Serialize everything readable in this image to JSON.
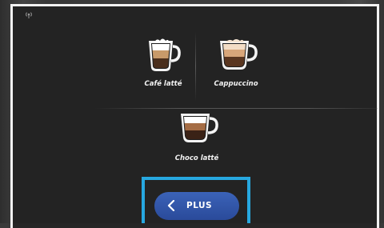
{
  "drinks": [
    {
      "label": "Café latté"
    },
    {
      "label": "Cappuccino"
    },
    {
      "label": "Choco latté"
    }
  ],
  "more_button": {
    "label": "PLUS",
    "icon": "chevron-left-icon"
  },
  "status": {
    "icon": "wifi-icon"
  },
  "colors": {
    "highlight": "#27a8e0",
    "button": "#3458ad",
    "screen": "#232323"
  }
}
